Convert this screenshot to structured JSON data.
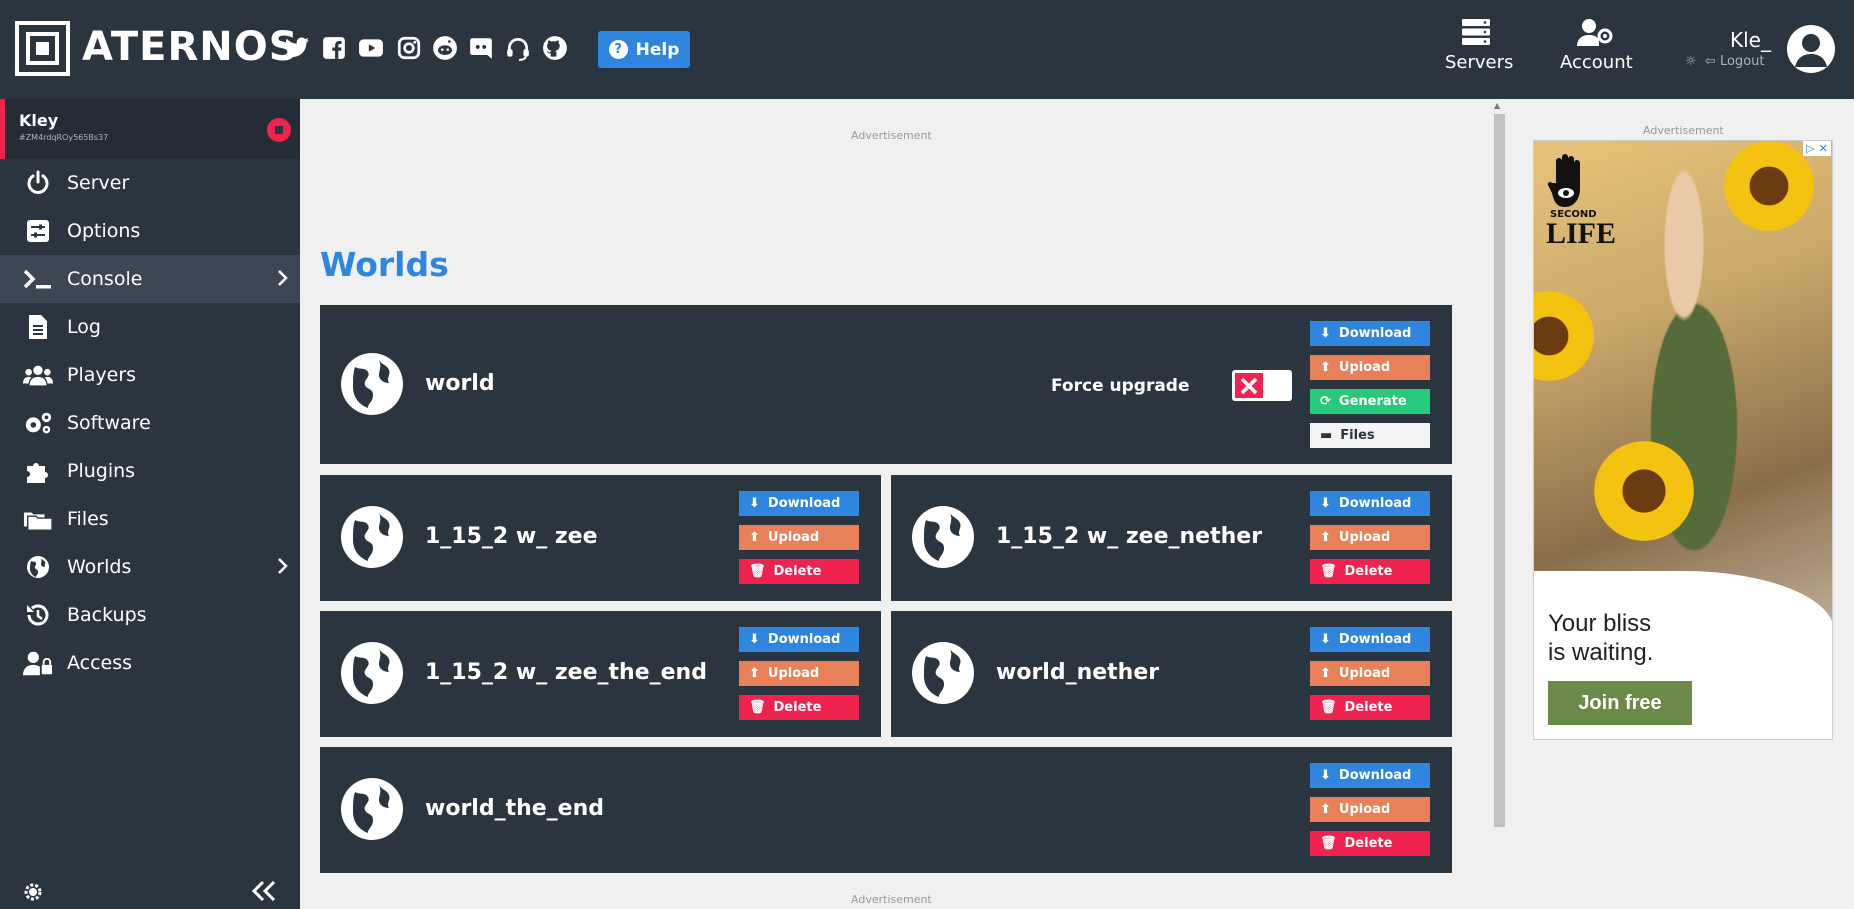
{
  "header": {
    "brand": "ATERNOS",
    "help_label": "Help",
    "nav": [
      {
        "label": "Servers",
        "icon": "server-icon"
      },
      {
        "label": "Account",
        "icon": "user-gear-icon"
      }
    ],
    "user_name": "Kle_",
    "logout_label": "Logout",
    "social_icons": [
      "twitter-icon",
      "facebook-icon",
      "youtube-icon",
      "instagram-icon",
      "reddit-icon",
      "discord-icon",
      "headset-icon",
      "github-icon"
    ]
  },
  "sidebar": {
    "server_name": "Kley",
    "server_id": "#ZM4rdqROy565Bs37",
    "items": [
      {
        "label": "Server",
        "icon": "power-icon"
      },
      {
        "label": "Options",
        "icon": "sliders-icon"
      },
      {
        "label": "Console",
        "icon": "terminal-icon"
      },
      {
        "label": "Log",
        "icon": "file-icon"
      },
      {
        "label": "Players",
        "icon": "users-icon"
      },
      {
        "label": "Software",
        "icon": "gears-icon"
      },
      {
        "label": "Plugins",
        "icon": "puzzle-icon"
      },
      {
        "label": "Files",
        "icon": "folders-icon"
      },
      {
        "label": "Worlds",
        "icon": "globe-icon"
      },
      {
        "label": "Backups",
        "icon": "history-icon"
      },
      {
        "label": "Access",
        "icon": "user-lock-icon"
      }
    ],
    "active": "Console"
  },
  "main": {
    "ad_label": "Advertisement",
    "title": "Worlds",
    "force_upgrade_label": "Force upgrade",
    "buttons": {
      "download": "Download",
      "upload": "Upload",
      "generate": "Generate",
      "files": "Files",
      "delete": "Delete"
    },
    "worlds": [
      {
        "name": "world"
      },
      {
        "name": "1_15_2 w_ zee"
      },
      {
        "name": "1_15_2 w_ zee_nether"
      },
      {
        "name": "1_15_2 w_ zee_the_end"
      },
      {
        "name": "world_nether"
      },
      {
        "name": "world_the_end"
      }
    ]
  },
  "right_ad": {
    "label": "Advertisement",
    "brand_small": "SECOND",
    "brand_large": "LIFE",
    "text_line1": "Your bliss",
    "text_line2": "is waiting.",
    "cta": "Join free"
  },
  "colors": {
    "header_bg": "#2b3540",
    "accent_blue": "#2e86de",
    "upload_orange": "#e8805a",
    "generate_green": "#27c97a",
    "delete_red": "#f0234f"
  }
}
